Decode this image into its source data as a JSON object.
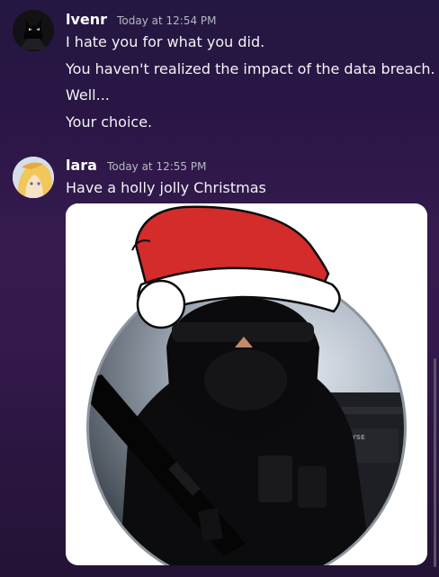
{
  "messages": [
    {
      "username": "lvenr",
      "timestamp": "Today at 12:54 PM",
      "lines": [
        "I hate you for what you did.",
        "You haven't realized the impact of the data breach.",
        "Well...",
        "Your choice."
      ]
    },
    {
      "username": "lara",
      "timestamp": "Today at 12:55 PM",
      "lines": [
        "Have a holly jolly Christmas"
      ],
      "attachment": {
        "patch_text": "NYSE"
      }
    }
  ],
  "colors": {
    "background_top": "#241741",
    "background_mid": "#351a4e",
    "text": "#f2f3f5",
    "timestamp": "#b5b9c2",
    "santa_hat_red": "#d42b2b"
  }
}
